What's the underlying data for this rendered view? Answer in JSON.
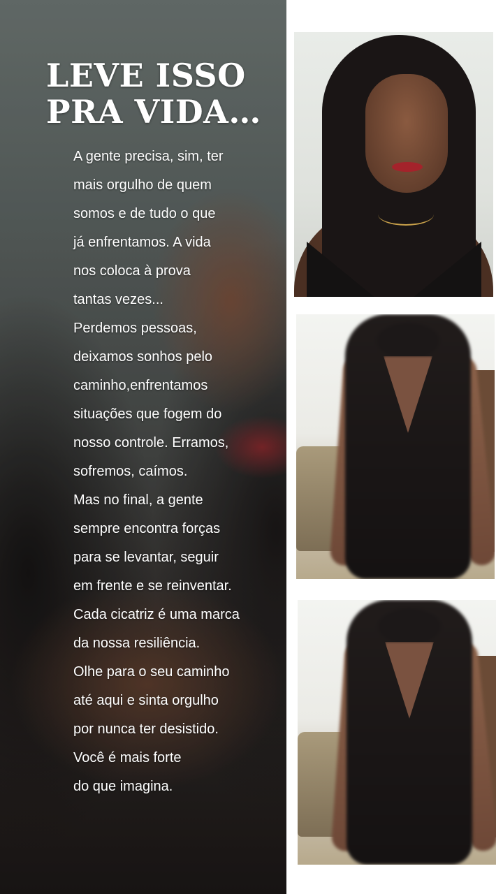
{
  "post": {
    "headline_lines": [
      "LEVE ISSO",
      "PRA VIDA…"
    ],
    "body_lines": [
      "A gente precisa, sim, ter",
      "mais orgulho de quem",
      "somos e de tudo o que",
      "já enfrentamos. A vida",
      "nos coloca à prova",
      "tantas vezes...",
      "Perdemos pessoas,",
      "deixamos sonhos pelo",
      "caminho,enfrentamos",
      "situações que fogem do",
      "nosso controle. Erramos,",
      "sofremos, caímos.",
      "Mas no final, a gente",
      "sempre encontra forças",
      "para se levantar, seguir",
      "em frente e se reinventar.",
      "Cada cicatriz é uma marca",
      "da nossa resiliência.",
      "Olhe para o seu caminho",
      "até aqui e sinta orgulho",
      "por nunca ter desistido.",
      "Você é mais forte",
      "do que imagina."
    ]
  },
  "colors": {
    "text": "#ffffff",
    "page_background": "#ffffff",
    "lips": "#a4232b",
    "dress": "#141212"
  }
}
